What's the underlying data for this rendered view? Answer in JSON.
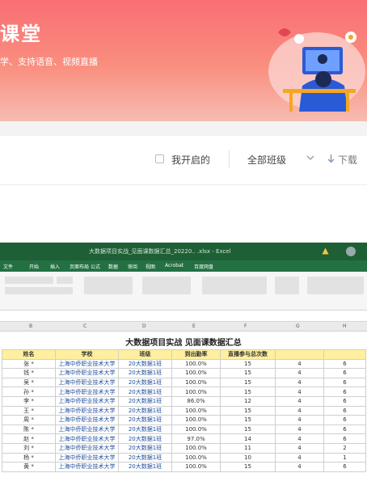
{
  "banner": {
    "title": "课堂",
    "subtitle": "学、支持语音、视频直播"
  },
  "filter": {
    "my_started_label": "我开启的",
    "class_select_value": "全部班级",
    "download_label": "下载"
  },
  "excel": {
    "title_text": "大数据项目实战_见面课数据汇总_20220..  .xlsx  -  Excel",
    "menu": [
      "文件",
      "开始",
      "插入",
      "页面布局",
      "公式",
      "数据",
      "审阅",
      "视图",
      "Acrobat",
      "百度网盘"
    ],
    "sheet_title": "大数据项目实战 见面课数据汇总",
    "column_letters": [
      "B",
      "C",
      "D",
      "E",
      "F",
      "G",
      "H"
    ],
    "headers": [
      "姓名",
      "学校",
      "班级",
      "到出勤率",
      "直播参与总次数",
      "",
      ""
    ],
    "rows": [
      [
        "张 *",
        "上海中侨职业技术大学",
        "20大数据1班",
        "100.0%",
        "15",
        "4",
        "6"
      ],
      [
        "钱 *",
        "上海中侨职业技术大学",
        "20大数据1班",
        "100.0%",
        "15",
        "4",
        "6"
      ],
      [
        "吴 *",
        "上海中侨职业技术大学",
        "20大数据1班",
        "100.0%",
        "15",
        "4",
        "6"
      ],
      [
        "孙 *",
        "上海中侨职业技术大学",
        "20大数据1班",
        "100.0%",
        "15",
        "4",
        "6"
      ],
      [
        "李 *",
        "上海中侨职业技术大学",
        "20大数据1班",
        "86.0%",
        "12",
        "4",
        "6"
      ],
      [
        "王 *",
        "上海中侨职业技术大学",
        "20大数据1班",
        "100.0%",
        "15",
        "4",
        "6"
      ],
      [
        "周 *",
        "上海中侨职业技术大学",
        "20大数据1班",
        "100.0%",
        "15",
        "4",
        "6"
      ],
      [
        "陈 *",
        "上海中侨职业技术大学",
        "20大数据1班",
        "100.0%",
        "15",
        "4",
        "6"
      ],
      [
        "赵 *",
        "上海中侨职业技术大学",
        "20大数据1班",
        "97.0%",
        "14",
        "4",
        "6"
      ],
      [
        "刘 *",
        "上海中侨职业技术大学",
        "20大数据1班",
        "100.0%",
        "11",
        "4",
        "2"
      ],
      [
        "杨 *",
        "上海中侨职业技术大学",
        "20大数据1班",
        "100.0%",
        "10",
        "4",
        "1"
      ],
      [
        "黄 *",
        "上海中侨职业技术大学",
        "20大数据1班",
        "100.0%",
        "15",
        "4",
        "6"
      ]
    ]
  },
  "colors": {
    "banner_start": "#f96e74",
    "banner_end": "#f7bcb2",
    "excel_green": "#237043",
    "header_yellow": "#ffef9e"
  }
}
